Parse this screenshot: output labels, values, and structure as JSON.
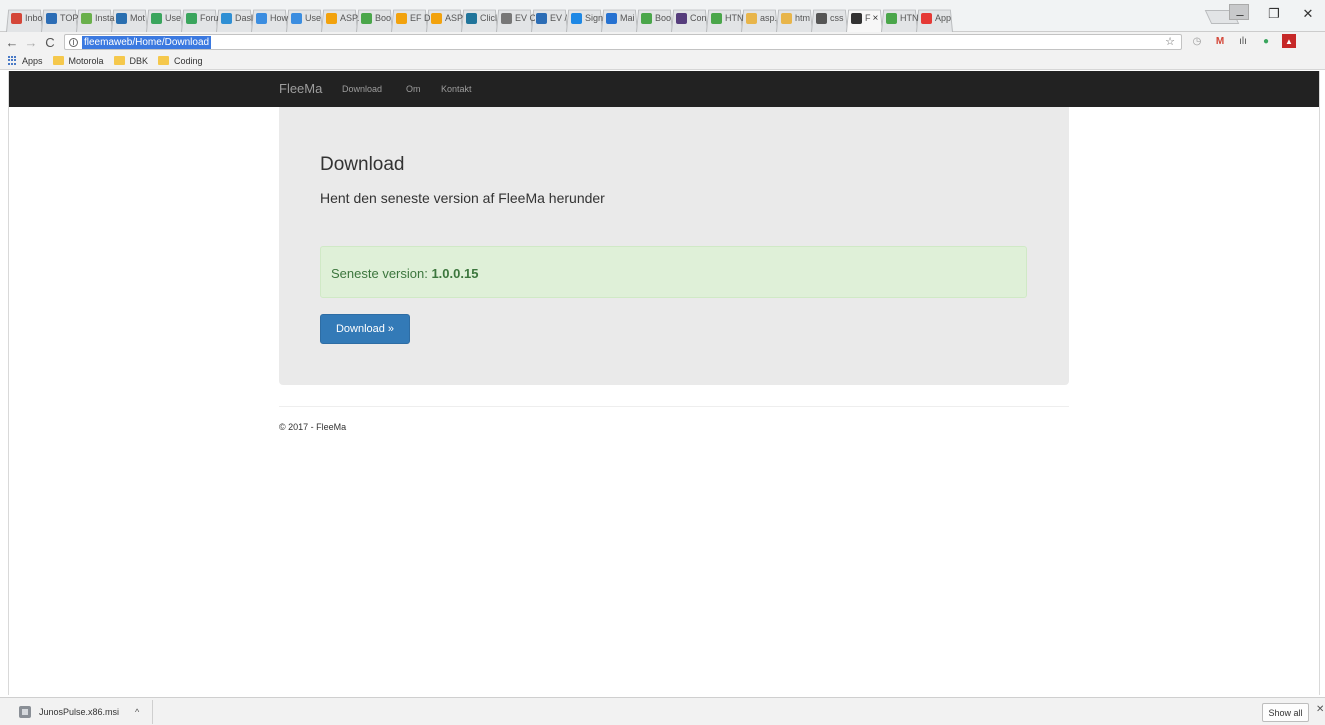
{
  "browser": {
    "tabs": [
      {
        "label": "Inbo",
        "icon": "gmail-icon",
        "color": "#d44638"
      },
      {
        "label": "TOP",
        "icon": "site-icon",
        "color": "#2c6db5"
      },
      {
        "label": "Insta",
        "icon": "site-icon",
        "color": "#6ab04c"
      },
      {
        "label": "Mot",
        "icon": "calendar-icon",
        "color": "#2a6fb0"
      },
      {
        "label": "Use",
        "icon": "site-icon",
        "color": "#3aa55d"
      },
      {
        "label": "Foru",
        "icon": "site-icon",
        "color": "#3aa55d"
      },
      {
        "label": "Dasl",
        "icon": "site-icon",
        "color": "#2f8fd4"
      },
      {
        "label": "How",
        "icon": "site-icon",
        "color": "#3b8de0"
      },
      {
        "label": "Use",
        "icon": "site-icon",
        "color": "#3b8de0"
      },
      {
        "label": "ASP.",
        "icon": "site-icon",
        "color": "#f2a20d"
      },
      {
        "label": "Boo",
        "icon": "site-icon",
        "color": "#4aa64a"
      },
      {
        "label": "EF D",
        "icon": "site-icon",
        "color": "#f2a20d"
      },
      {
        "label": "ASP",
        "icon": "site-icon",
        "color": "#f2a20d"
      },
      {
        "label": "Clicl",
        "icon": "wordpress-icon",
        "color": "#21759b"
      },
      {
        "label": "EV C",
        "icon": "document-icon",
        "color": "#777777"
      },
      {
        "label": "EV /",
        "icon": "site-icon",
        "color": "#2c6db5"
      },
      {
        "label": "Sign",
        "icon": "windows-icon",
        "color": "#1e88e5"
      },
      {
        "label": "Mai",
        "icon": "outlook-icon",
        "color": "#2672d1"
      },
      {
        "label": "Boo",
        "icon": "site-icon",
        "color": "#4aa64a"
      },
      {
        "label": "Con",
        "icon": "bootstrap-icon",
        "color": "#563d7c"
      },
      {
        "label": "HTN",
        "icon": "site-icon",
        "color": "#4aa64a"
      },
      {
        "label": "asp.",
        "icon": "site-icon",
        "color": "#e8b54a"
      },
      {
        "label": "htm",
        "icon": "site-icon",
        "color": "#e8b54a"
      },
      {
        "label": "css",
        "icon": "site-icon",
        "color": "#555555"
      },
      {
        "label": "F",
        "icon": "app-icon",
        "color": "#333333",
        "active": true
      },
      {
        "label": "HTN",
        "icon": "site-icon",
        "color": "#4aa64a"
      },
      {
        "label": "App",
        "icon": "record-icon",
        "color": "#e53935"
      }
    ],
    "window_controls": {
      "minimize": "–",
      "maximize": "❐",
      "close": "✕"
    },
    "address": {
      "url": "fleemaweb/Home/Download"
    },
    "bookmarks": [
      {
        "label": "Apps",
        "type": "apps"
      },
      {
        "label": "Motorola",
        "type": "folder"
      },
      {
        "label": "DBK",
        "type": "folder"
      },
      {
        "label": "Coding",
        "type": "folder"
      }
    ]
  },
  "navbar": {
    "brand": "FleeMa",
    "links": [
      "Download",
      "Om",
      "Kontakt"
    ]
  },
  "jumbotron": {
    "title": "Download",
    "lead": "Hent den seneste version af FleeMa herunder",
    "alert_label": "Seneste version: ",
    "version": "1.0.0.15",
    "button": "Download »"
  },
  "footer": {
    "text": "© 2017 - FleeMa"
  },
  "download_shelf": {
    "filename": "JunosPulse.x86.msi",
    "show_all": "Show all"
  }
}
